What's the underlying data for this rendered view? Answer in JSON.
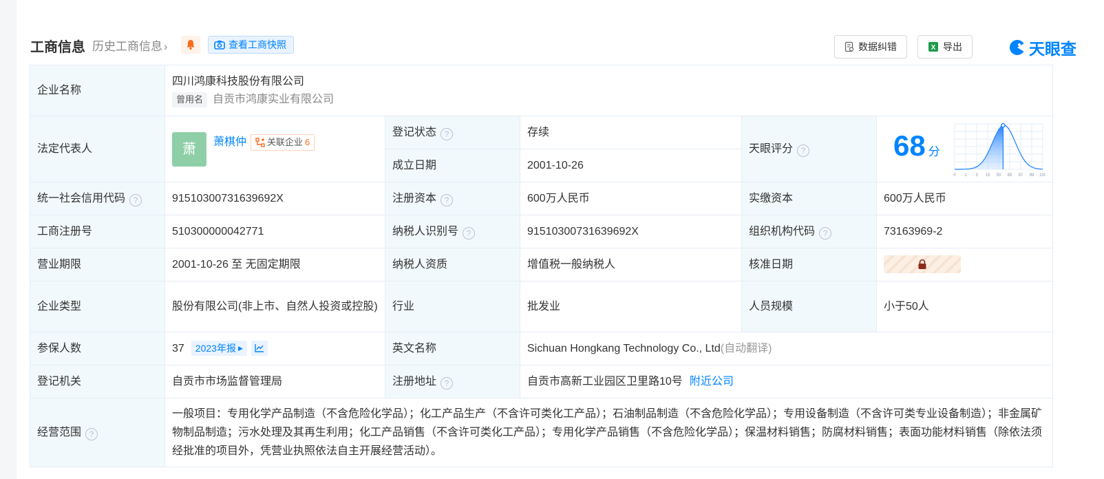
{
  "header": {
    "title": "工商信息",
    "history_link": "历史工商信息",
    "snapshot_btn": "查看工商快照",
    "feedback_btn": "数据纠错",
    "export_btn": "导出",
    "brand": "天眼查"
  },
  "company": {
    "name_label": "企业名称",
    "name": "四川鸿康科技股份有限公司",
    "former_tag": "曾用名",
    "former_name": "自贡市鸿康实业有限公司"
  },
  "rep": {
    "label": "法定代表人",
    "avatar_char": "萧",
    "name": "萧棋仲",
    "related_label": "关联企业",
    "related_count": "6"
  },
  "status": {
    "label": "登记状态",
    "value": "存续"
  },
  "founded": {
    "label": "成立日期",
    "value": "2001-10-26"
  },
  "tianyan": {
    "label": "天眼评分",
    "score": "68",
    "unit": "分",
    "axis": [
      "0",
      "1",
      "3",
      "15",
      "50",
      "85",
      "97",
      "99",
      "100"
    ]
  },
  "credit": {
    "label": "统一社会信用代码",
    "value": "91510300731639692X"
  },
  "capital": {
    "label": "注册资本",
    "value": "600万人民币"
  },
  "paid": {
    "label": "实缴资本",
    "value": "600万人民币"
  },
  "reg_no": {
    "label": "工商注册号",
    "value": "510300000042771"
  },
  "tax_id": {
    "label": "纳税人识别号",
    "value": "91510300731639692X"
  },
  "org_code": {
    "label": "组织机构代码",
    "value": "73163969-2"
  },
  "term": {
    "label": "营业期限",
    "value": "2001-10-26 至 无固定期限"
  },
  "taxpayer": {
    "label": "纳税人资质",
    "value": "增值税一般纳税人"
  },
  "approval": {
    "label": "核准日期"
  },
  "type": {
    "label": "企业类型",
    "value": "股份有限公司(非上市、自然人投资或控股)"
  },
  "industry": {
    "label": "行业",
    "value": "批发业"
  },
  "staff": {
    "label": "人员规模",
    "value": "小于50人"
  },
  "insured": {
    "label": "参保人数",
    "value": "37",
    "year_tag": "2023年报"
  },
  "english": {
    "label": "英文名称",
    "value": "Sichuan Hongkang Technology Co., Ltd",
    "note": "(自动翻译)"
  },
  "authority": {
    "label": "登记机关",
    "value": "自贡市市场监督管理局"
  },
  "address": {
    "label": "注册地址",
    "value": "自贡市高新工业园区卫里路10号",
    "nearby": "附近公司"
  },
  "scope": {
    "label": "经营范围",
    "value": "一般项目：专用化学产品制造（不含危险化学品）；化工产品生产（不含许可类化工产品）；石油制品制造（不含危险化学品）；专用设备制造（不含许可类专业设备制造）；非金属矿物制品制造；污水处理及其再生利用；化工产品销售（不含许可类化工产品）；专用化学产品销售（不含危险化学品）；保温材料销售；防腐材料销售；表面功能材料销售（除依法须经批准的项目外，凭营业执照依法自主开展经营活动）。"
  },
  "colors": {
    "accent": "#0084ff",
    "label_bg": "#f2f9fc",
    "status_green": "#22a34a"
  }
}
